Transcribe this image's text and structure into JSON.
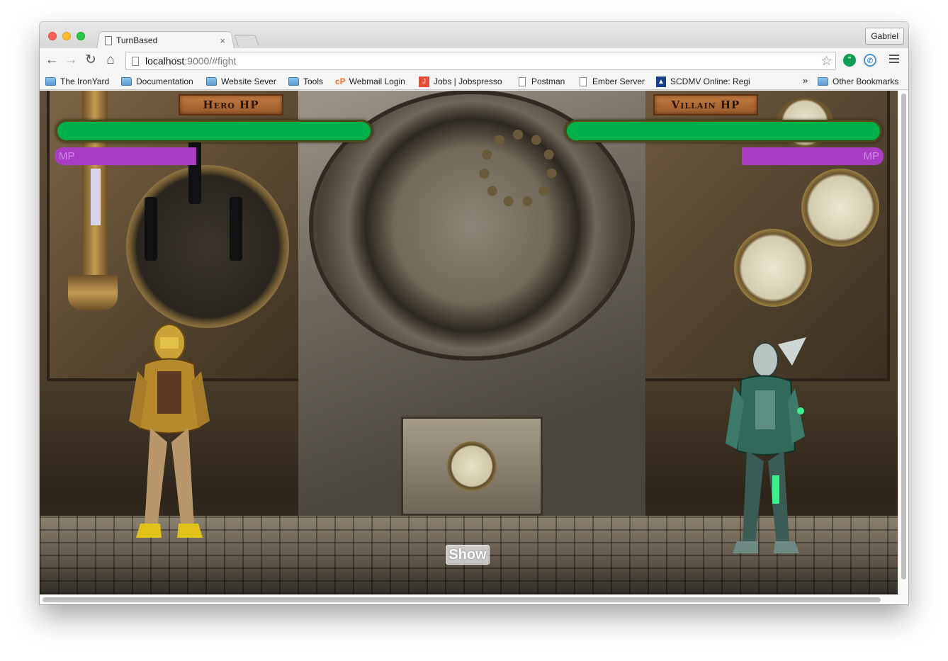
{
  "browser": {
    "tab_title": "TurnBased",
    "tab_close": "×",
    "profile_name": "Gabriel",
    "url_host": "localhost",
    "url_path": ":9000/#fight",
    "icons": {
      "back": "back-arrow-icon",
      "forward": "forward-arrow-icon",
      "reload": "reload-icon",
      "home": "home-icon",
      "star": "bookmark-star-icon",
      "menu": "hamburger-menu-icon"
    }
  },
  "bookmarks": {
    "items": [
      {
        "label": "The IronYard",
        "icon": "folder-icon"
      },
      {
        "label": "Documentation",
        "icon": "folder-icon"
      },
      {
        "label": "Website Sever",
        "icon": "folder-icon"
      },
      {
        "label": "Tools",
        "icon": "folder-icon"
      },
      {
        "label": "Webmail Login",
        "icon": "cpanel-icon"
      },
      {
        "label": "Jobs | Jobspresso",
        "icon": "jobspresso-icon"
      },
      {
        "label": "Postman",
        "icon": "page-icon"
      },
      {
        "label": "Ember Server",
        "icon": "page-icon"
      },
      {
        "label": "SCDMV Online: Regi",
        "icon": "palmetto-flag-icon"
      }
    ],
    "overflow": "»",
    "other_bookmarks": "Other Bookmarks"
  },
  "game": {
    "hero_hp_title": "Hero HP",
    "villain_hp_title": "Villain HP",
    "hero_hp_fraction": 1.0,
    "villain_hp_fraction": 1.0,
    "hero_mp_label": "MP",
    "villain_mp_label": "MP",
    "show_button": "Show",
    "colors": {
      "hp": "#00b04a",
      "mp": "#a93ec4"
    }
  }
}
